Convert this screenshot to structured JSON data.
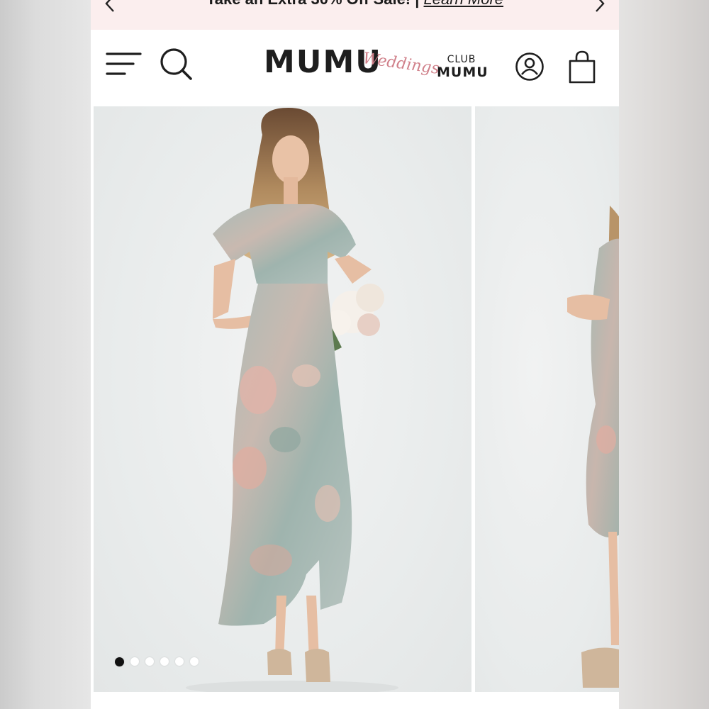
{
  "promo": {
    "text": "Take an Extra 30% Off Sale! | ",
    "link": "Learn More"
  },
  "header": {
    "logo_main": "MUMU",
    "logo_script": "Weddings",
    "club_top": "CLUB",
    "club_bottom": "MUMU"
  },
  "icons": {
    "menu": "hamburger-menu-icon",
    "search": "search-icon",
    "account": "account-icon",
    "bag": "shopping-bag-icon",
    "prev": "chevron-left-icon",
    "next": "chevron-right-icon"
  },
  "gallery": {
    "slide_count": 6,
    "active_slide": 1
  },
  "colors": {
    "promo_bg": "#fbeeee",
    "script_pink": "#d0808a",
    "dress_sage": "#9fb3ad",
    "dress_blush": "#e2b5ab"
  }
}
